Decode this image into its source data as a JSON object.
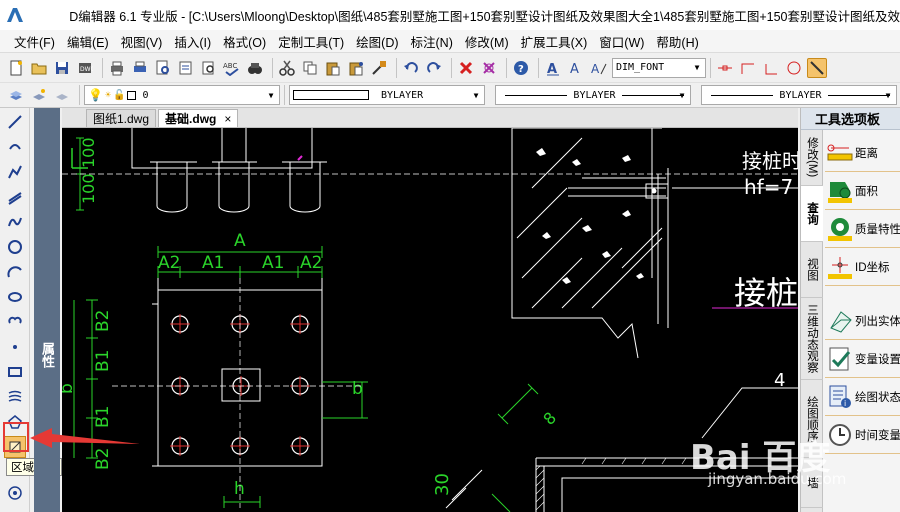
{
  "window": {
    "title": "D编辑器 6.1 专业版  - [C:\\Users\\Mloong\\Desktop\\图纸\\485套别墅施工图+150套别墅设计图纸及效果图大全1\\485套别墅施工图+150套别墅设计图纸及效"
  },
  "menu": [
    "文件(F)",
    "编辑(E)",
    "视图(V)",
    "插入(I)",
    "格式(O)",
    "定制工具(T)",
    "绘图(D)",
    "标注(N)",
    "修改(M)",
    "扩展工具(X)",
    "窗口(W)",
    "帮助(H)"
  ],
  "toolbar": {
    "textstyle": "DIM_FONT"
  },
  "props": {
    "layer": "0",
    "color_label": "BYLAYER",
    "linetype": "BYLAYER",
    "lineweight": "BYLAYER"
  },
  "left_strip": {
    "label": "属性"
  },
  "tooltip": {
    "text": "区域覆盖"
  },
  "tabs": [
    {
      "label": "图纸1.dwg"
    },
    {
      "label": "基础.dwg"
    }
  ],
  "tab_close": "×",
  "drawing": {
    "dim_A": "A",
    "dim_A2_left": "A2",
    "dim_A1_left": "A1",
    "dim_A1_right": "A1",
    "dim_A2_right": "A2",
    "dim_B2_top": "B2",
    "dim_B1_top": "B1",
    "dim_B1_bot": "B1",
    "dim_B2_bot": "B2",
    "dim_b_left": "b",
    "dim_b_right": "b",
    "dim_h": "h",
    "dim_100_a": "100",
    "dim_100_b": "100",
    "dim_30": "30",
    "dim_8": "8",
    "text_jiezhuang1": "接桩时",
    "text_hf": "hf=7",
    "text_jiezhuang2": "接桩",
    "text_4": "4"
  },
  "right_panel": {
    "title": "工具选项板",
    "tabs": [
      "修改(M)",
      "查询",
      "视图",
      "三维动态观察",
      "绘图顺序",
      "墙"
    ],
    "items": [
      {
        "label": "距离"
      },
      {
        "label": "面积"
      },
      {
        "label": "质量特性"
      },
      {
        "label": "ID坐标"
      },
      {
        "label": "列出实体"
      },
      {
        "label": "变量设置"
      },
      {
        "label": "绘图状态"
      },
      {
        "label": "时间变量"
      }
    ]
  },
  "watermark": {
    "brand": "Bai 百度",
    "site": "jingyan.baidu.com"
  }
}
